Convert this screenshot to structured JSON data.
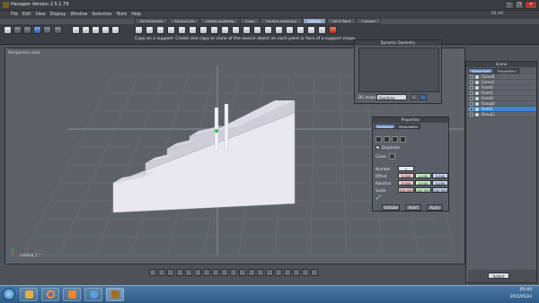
{
  "app": {
    "title": "Hexagon Version 2.5.1.79",
    "clock": "05:39",
    "window_controls": [
      "–",
      "❐",
      "✕"
    ]
  },
  "menu": [
    "File",
    "Edit",
    "View",
    "Display",
    "Window",
    "Selection",
    "Tools",
    "Help"
  ],
  "mode_tabs": [
    {
      "label": "3D Primitives",
      "active": false
    },
    {
      "label": "Second Life",
      "active": false
    },
    {
      "label": "Vertex modeling",
      "active": false
    },
    {
      "label": "Lines",
      "active": false
    },
    {
      "label": "Surface modeling",
      "active": false
    },
    {
      "label": "Utilities",
      "active": true
    },
    {
      "label": "UV & Paint",
      "active": false
    },
    {
      "label": "Custom",
      "active": false
    }
  ],
  "toolbar": {
    "hint": "Copy on a support: Create one copy or clone of the source object on each point or face of a support shape."
  },
  "viewport": {
    "label": "Perspective view",
    "object_label": "untitled_1 *"
  },
  "dynamic_geometry": {
    "title": "Dynamic Geometry",
    "mode_label": "DG mode:",
    "mode_value": "Realtime"
  },
  "scene": {
    "title": "Scene",
    "tabs": [
      {
        "label": "Scene tree",
        "active": true
      },
      {
        "label": "Properties",
        "active": false
      }
    ],
    "items": [
      {
        "label": "Curve0",
        "selected": false
      },
      {
        "label": "Curve1",
        "selected": false
      },
      {
        "label": "Form0",
        "selected": false
      },
      {
        "label": "Form1",
        "selected": false
      },
      {
        "label": "Form0",
        "selected": false
      },
      {
        "label": "Group0",
        "selected": false
      },
      {
        "label": "Form1",
        "selected": true
      },
      {
        "label": "Group1",
        "selected": false
      }
    ],
    "select_button": "Select"
  },
  "properties": {
    "title": "Properties",
    "tabs": [
      {
        "label": "Summary",
        "active": true
      },
      {
        "label": "Tab",
        "active": false
      },
      {
        "label": "Tab",
        "active": false
      },
      {
        "label": "Tab",
        "active": false
      },
      {
        "label": "Tab",
        "active": false
      },
      {
        "label": "Tab",
        "active": false
      }
    ],
    "subtab": "Parameters",
    "option": "Duplicate",
    "clone_label": "Clone",
    "number_label": "Number",
    "number_value": "1",
    "offset_label": "Offset",
    "offset_values": [
      "0.000",
      "0.000",
      "0.000"
    ],
    "rotation_label": "Rotation",
    "rotation_values": [
      "0.000",
      "0.000",
      "0.000"
    ],
    "scale_label": "Scale",
    "scale_values": [
      "100.000",
      "100.000",
      "100.000"
    ],
    "buttons": {
      "validate": "Validate",
      "abort": "Abort",
      "apply": "Apply"
    }
  },
  "taskbar": {
    "time": "05:40",
    "date": "2015/05/24"
  },
  "colors": {
    "accent": "#3d86d6",
    "active_tab": "#8aa4c8",
    "object_face": "#e9e8f0",
    "offset_field": "#f2c7c7",
    "rotation_field": "#c9f2c9",
    "scale_field": "#c9d6f2"
  }
}
